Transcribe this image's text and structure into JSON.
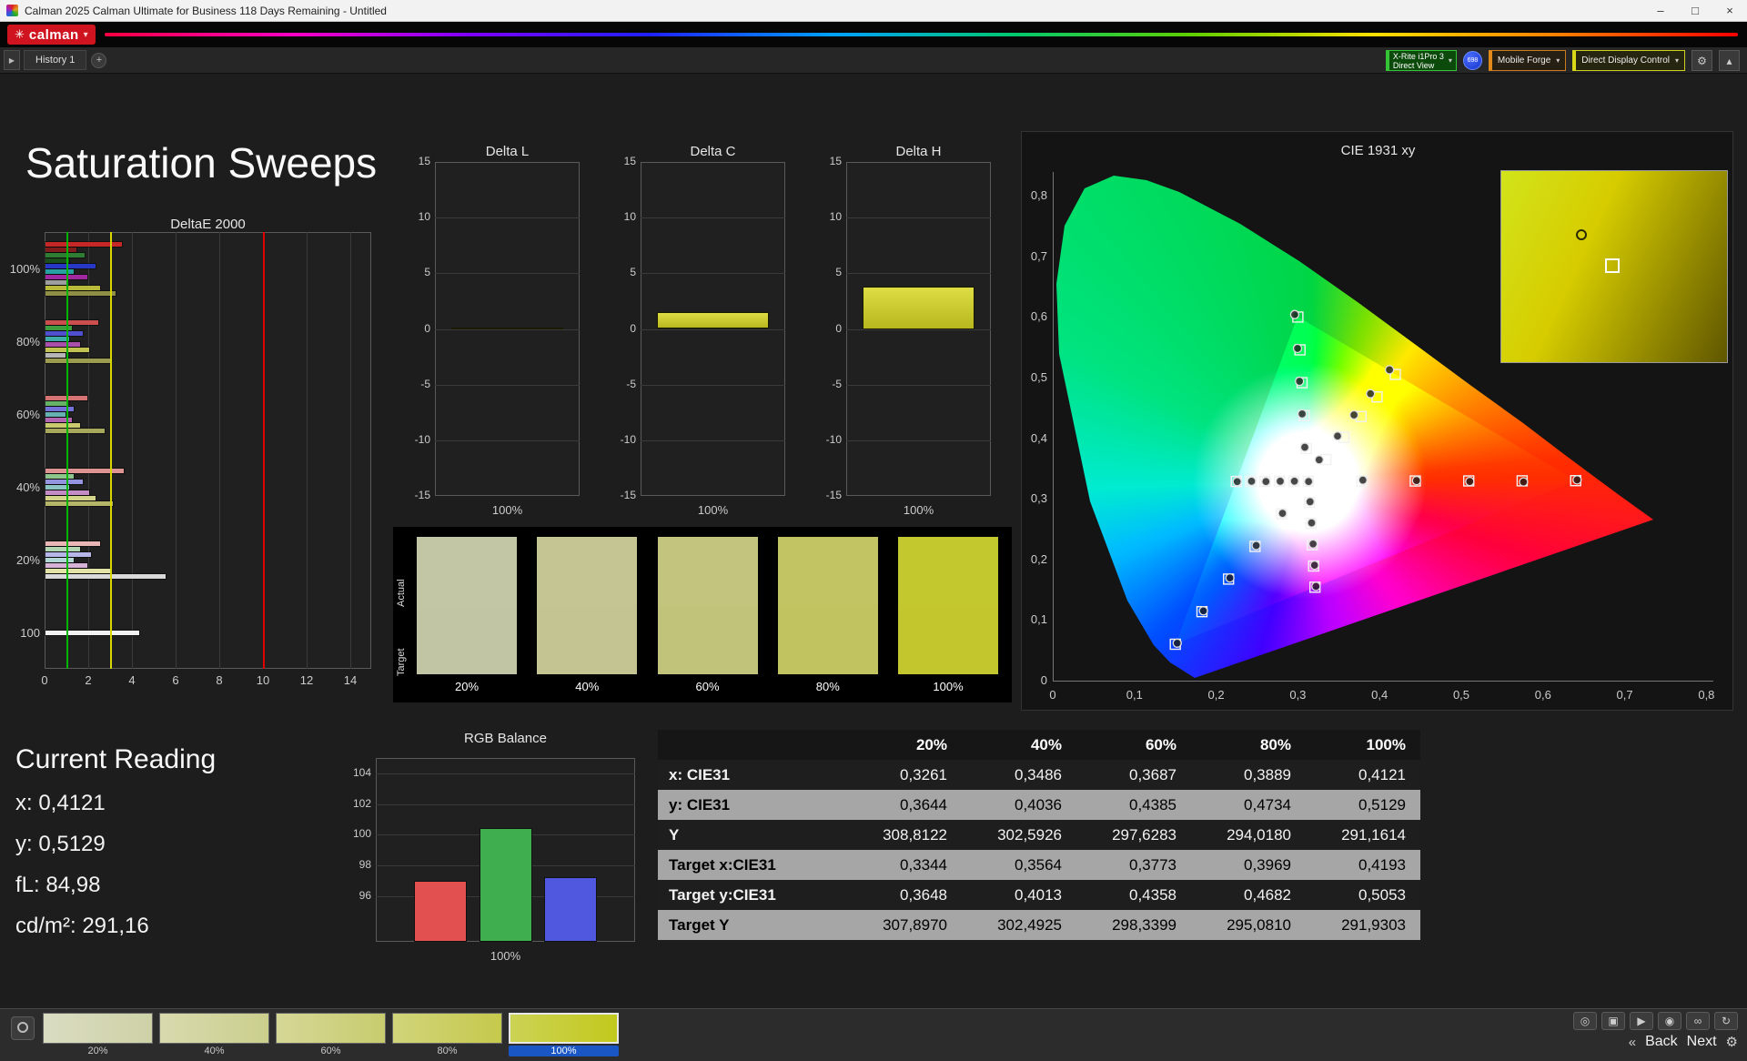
{
  "window": {
    "title": "Calman 2025 Calman Ultimate for Business 118 Days Remaining - Untitled",
    "minimize": "–",
    "maximize": "□",
    "close": "×",
    "brand": "calman",
    "brand_flower": "✳",
    "brand_caret": "▾"
  },
  "toolbar": {
    "panel_toggle": "▶",
    "history_tab": "History 1",
    "history_add": "+",
    "meter_line1": "X-Rite i1Pro 3",
    "meter_line2": "Direct View",
    "meter_caret": "▾",
    "meter_badge": "698",
    "source_label": "Mobile Forge",
    "source_caret": "▾",
    "display_label": "Direct Display Control",
    "display_caret": "▾",
    "settings_icon": "⚙",
    "collapse_icon": "▴"
  },
  "page": {
    "title": "Saturation Sweeps"
  },
  "current_reading": {
    "title": "Current Reading",
    "lines": [
      "x: 0,4121",
      "y: 0,5129",
      "fL: 84,98",
      "cd/m²: 291,16"
    ]
  },
  "chart_data": {
    "deltaE": {
      "type": "bar",
      "orientation": "horizontal",
      "title": "DeltaE 2000",
      "xlim": [
        0,
        14
      ],
      "xticks": [
        "0",
        "2",
        "4",
        "6",
        "8",
        "10",
        "12",
        "14"
      ],
      "ref_lines": [
        {
          "x": 1,
          "color": "#00b400"
        },
        {
          "x": 3,
          "color": "#d6d600"
        },
        {
          "x": 10,
          "color": "#e00000"
        }
      ],
      "groups": [
        {
          "label": "100%",
          "bars": [
            {
              "c": "#c62828",
              "v": 3.5
            },
            {
              "c": "#7f1d1d",
              "v": 1.4
            },
            {
              "c": "#2e7d32",
              "v": 1.8
            },
            {
              "c": "#1b4d1b",
              "v": 1.1
            },
            {
              "c": "#2838c6",
              "v": 2.3
            },
            {
              "c": "#26a0a0",
              "v": 1.3
            },
            {
              "c": "#a028a0",
              "v": 1.9
            },
            {
              "c": "#9e9e9e",
              "v": 1.0
            },
            {
              "c": "#b9b93a",
              "v": 2.5
            },
            {
              "c": "#8f8f45",
              "v": 3.2
            }
          ]
        },
        {
          "label": "80%",
          "bars": [
            {
              "c": "#cc4f4f",
              "v": 2.4
            },
            {
              "c": "#3f9d3f",
              "v": 1.2
            },
            {
              "c": "#4f4fd0",
              "v": 1.7
            },
            {
              "c": "#3fa9a9",
              "v": 1.1
            },
            {
              "c": "#aa4faa",
              "v": 1.6
            },
            {
              "c": "#c2c253",
              "v": 2.0
            },
            {
              "c": "#b5b5b5",
              "v": 0.9
            },
            {
              "c": "#9c9c50",
              "v": 3.0
            }
          ]
        },
        {
          "label": "60%",
          "bars": [
            {
              "c": "#d57272",
              "v": 1.9
            },
            {
              "c": "#66b266",
              "v": 1.0
            },
            {
              "c": "#7272d8",
              "v": 1.3
            },
            {
              "c": "#66b2b2",
              "v": 0.9
            },
            {
              "c": "#b266b2",
              "v": 1.2
            },
            {
              "c": "#caca6e",
              "v": 1.6
            },
            {
              "c": "#a8a85c",
              "v": 2.7
            }
          ]
        },
        {
          "label": "40%",
          "bars": [
            {
              "c": "#df9494",
              "v": 3.6
            },
            {
              "c": "#8cc48c",
              "v": 1.3
            },
            {
              "c": "#9494e0",
              "v": 1.7
            },
            {
              "c": "#8cc4c4",
              "v": 1.1
            },
            {
              "c": "#c48cc4",
              "v": 2.0
            },
            {
              "c": "#d3d38a",
              "v": 2.3
            },
            {
              "c": "#b5b56a",
              "v": 3.1
            }
          ]
        },
        {
          "label": "20%",
          "bars": [
            {
              "c": "#e9b6b6",
              "v": 2.5
            },
            {
              "c": "#b2d6b2",
              "v": 1.6
            },
            {
              "c": "#b6b6e9",
              "v": 2.1
            },
            {
              "c": "#b2d6d6",
              "v": 1.3
            },
            {
              "c": "#d6b2d6",
              "v": 1.9
            },
            {
              "c": "#e3e3a8",
              "v": 3.0
            },
            {
              "c": "#d9d9d9",
              "v": 5.5
            }
          ]
        },
        {
          "label": "100",
          "bars": [
            {
              "c": "#f2f2f2",
              "v": 4.3
            }
          ]
        }
      ]
    },
    "deltaL": {
      "type": "bar",
      "title": "Delta L",
      "ylim": [
        -15,
        15
      ],
      "yticks": [
        "15",
        "10",
        "5",
        "0",
        "-5",
        "-10",
        "-15"
      ],
      "categories": [
        "100%"
      ],
      "values": [
        0.1
      ]
    },
    "deltaC": {
      "type": "bar",
      "title": "Delta C",
      "ylim": [
        -15,
        15
      ],
      "yticks": [
        "15",
        "10",
        "5",
        "0",
        "-5",
        "-10",
        "-15"
      ],
      "categories": [
        "100%"
      ],
      "values": [
        1.5
      ]
    },
    "deltaH": {
      "type": "bar",
      "title": "Delta H",
      "ylim": [
        -15,
        15
      ],
      "yticks": [
        "15",
        "10",
        "5",
        "0",
        "-5",
        "-10",
        "-15"
      ],
      "categories": [
        "100%"
      ],
      "values": [
        3.8
      ]
    },
    "rgb_balance": {
      "type": "bar",
      "title": "RGB Balance",
      "ylim": [
        93,
        105
      ],
      "yticks": [
        "104",
        "102",
        "100",
        "98",
        "96"
      ],
      "categories": [
        "100%"
      ],
      "series": [
        {
          "name": "Red",
          "value": 97.0,
          "color": "#e35050"
        },
        {
          "name": "Green",
          "value": 100.4,
          "color": "#3fae4e"
        },
        {
          "name": "Blue",
          "value": 97.2,
          "color": "#5058e0"
        }
      ]
    },
    "cie": {
      "type": "scatter",
      "title": "CIE 1931 xy",
      "xlim": [
        0,
        0.8
      ],
      "ylim": [
        0,
        0.8
      ],
      "xticks": [
        "0",
        "0,1",
        "0,2",
        "0,3",
        "0,4",
        "0,5",
        "0,6",
        "0,7",
        "0,8"
      ],
      "yticks": [
        "0",
        "0,1",
        "0,2",
        "0,3",
        "0,4",
        "0,5",
        "0,6",
        "0,7",
        "0,8"
      ],
      "white_point": [
        0.3127,
        0.329
      ],
      "gamut_triangle": [
        [
          0.64,
          0.33
        ],
        [
          0.3,
          0.6
        ],
        [
          0.15,
          0.06
        ]
      ],
      "targets": [
        [
          0.3127,
          0.329
        ],
        [
          0.3782,
          0.3292
        ],
        [
          0.4436,
          0.3294
        ],
        [
          0.5091,
          0.3296
        ],
        [
          0.5745,
          0.3298
        ],
        [
          0.64,
          0.33
        ],
        [
          0.3102,
          0.3832
        ],
        [
          0.3076,
          0.4374
        ],
        [
          0.3051,
          0.4916
        ],
        [
          0.3026,
          0.5458
        ],
        [
          0.3,
          0.6
        ],
        [
          0.2802,
          0.2752
        ],
        [
          0.2476,
          0.2214
        ],
        [
          0.2151,
          0.1676
        ],
        [
          0.1826,
          0.1138
        ],
        [
          0.15,
          0.06
        ],
        [
          0.2951,
          0.3289
        ],
        [
          0.2775,
          0.3289
        ],
        [
          0.2598,
          0.3288
        ],
        [
          0.2422,
          0.3288
        ],
        [
          0.2246,
          0.3287
        ],
        [
          0.3143,
          0.294
        ],
        [
          0.316,
          0.2591
        ],
        [
          0.3176,
          0.2241
        ],
        [
          0.3193,
          0.1892
        ],
        [
          0.3209,
          0.1542
        ],
        [
          0.3344,
          0.3648
        ],
        [
          0.3564,
          0.4013
        ],
        [
          0.3773,
          0.4358
        ],
        [
          0.3969,
          0.4682
        ],
        [
          0.4193,
          0.5053
        ]
      ],
      "measured": [
        [
          0.3131,
          0.3285
        ],
        [
          0.3795,
          0.331
        ],
        [
          0.4452,
          0.3302
        ],
        [
          0.5104,
          0.3287
        ],
        [
          0.5762,
          0.3279
        ],
        [
          0.6418,
          0.3312
        ],
        [
          0.3085,
          0.3851
        ],
        [
          0.3052,
          0.4401
        ],
        [
          0.302,
          0.494
        ],
        [
          0.2995,
          0.5482
        ],
        [
          0.2961,
          0.6041
        ],
        [
          0.2812,
          0.2761
        ],
        [
          0.249,
          0.223
        ],
        [
          0.2168,
          0.1695
        ],
        [
          0.1844,
          0.1152
        ],
        [
          0.1523,
          0.0618
        ],
        [
          0.2958,
          0.3292
        ],
        [
          0.2784,
          0.329
        ],
        [
          0.2609,
          0.3285
        ],
        [
          0.2433,
          0.329
        ],
        [
          0.2257,
          0.3284
        ],
        [
          0.3149,
          0.2952
        ],
        [
          0.3168,
          0.2604
        ],
        [
          0.3186,
          0.2255
        ],
        [
          0.3204,
          0.1905
        ],
        [
          0.3222,
          0.1556
        ],
        [
          0.3261,
          0.3644
        ],
        [
          0.3486,
          0.4036
        ],
        [
          0.3687,
          0.4385
        ],
        [
          0.3889,
          0.4734
        ],
        [
          0.4121,
          0.5129
        ]
      ]
    }
  },
  "saturation_swatches": {
    "row_labels": [
      "Actual",
      "Target"
    ],
    "columns": [
      {
        "label": "20%",
        "actual": "#c3c6a5",
        "target": "#c2c5a3"
      },
      {
        "label": "40%",
        "actual": "#c4c593",
        "target": "#c3c491"
      },
      {
        "label": "60%",
        "actual": "#c3c47d",
        "target": "#c2c37b"
      },
      {
        "label": "80%",
        "actual": "#c2c463",
        "target": "#c1c361"
      },
      {
        "label": "100%",
        "actual": "#c4c82f",
        "target": "#c3c72d"
      }
    ]
  },
  "table": {
    "columns": [
      "",
      "20%",
      "40%",
      "60%",
      "80%",
      "100%"
    ],
    "rows": [
      {
        "label": "x: CIE31",
        "values": [
          "0,3261",
          "0,3486",
          "0,3687",
          "0,3889",
          "0,4121"
        ]
      },
      {
        "label": "y: CIE31",
        "values": [
          "0,3644",
          "0,4036",
          "0,4385",
          "0,4734",
          "0,5129"
        ]
      },
      {
        "label": "Y",
        "values": [
          "308,8122",
          "302,5926",
          "297,6283",
          "294,0180",
          "291,1614"
        ]
      },
      {
        "label": "Target x:CIE31",
        "values": [
          "0,3344",
          "0,3564",
          "0,3773",
          "0,3969",
          "0,4193"
        ]
      },
      {
        "label": "Target y:CIE31",
        "values": [
          "0,3648",
          "0,4013",
          "0,4358",
          "0,4682",
          "0,5053"
        ]
      },
      {
        "label": "Target Y",
        "values": [
          "307,8970",
          "302,4925",
          "298,3399",
          "295,0810",
          "291,9303"
        ]
      }
    ]
  },
  "bottom_bar": {
    "swatch_buttons": [
      {
        "label": "20%",
        "g1": "#dadcc2",
        "g2": "#ced2a6",
        "selected": false
      },
      {
        "label": "40%",
        "g1": "#d8daae",
        "g2": "#cbcf8c",
        "selected": false
      },
      {
        "label": "60%",
        "g1": "#d5d796",
        "g2": "#c8cc6e",
        "selected": false
      },
      {
        "label": "80%",
        "g1": "#d1d47a",
        "g2": "#c5c94c",
        "selected": false
      },
      {
        "label": "100%",
        "g1": "#ccd254",
        "g2": "#c2c91d",
        "selected": true
      }
    ],
    "icon_buttons": [
      {
        "name": "levels-icon",
        "glyph": "◎"
      },
      {
        "name": "lock-icon",
        "glyph": "▣"
      },
      {
        "name": "play-icon",
        "glyph": "▶"
      },
      {
        "name": "target-icon",
        "glyph": "◉"
      },
      {
        "name": "link-icon",
        "glyph": "∞"
      },
      {
        "name": "refresh-icon",
        "glyph": "↻"
      }
    ],
    "back_icon": "«",
    "back_label": "Back",
    "next_label": "Next",
    "gear_icon": "⚙"
  }
}
